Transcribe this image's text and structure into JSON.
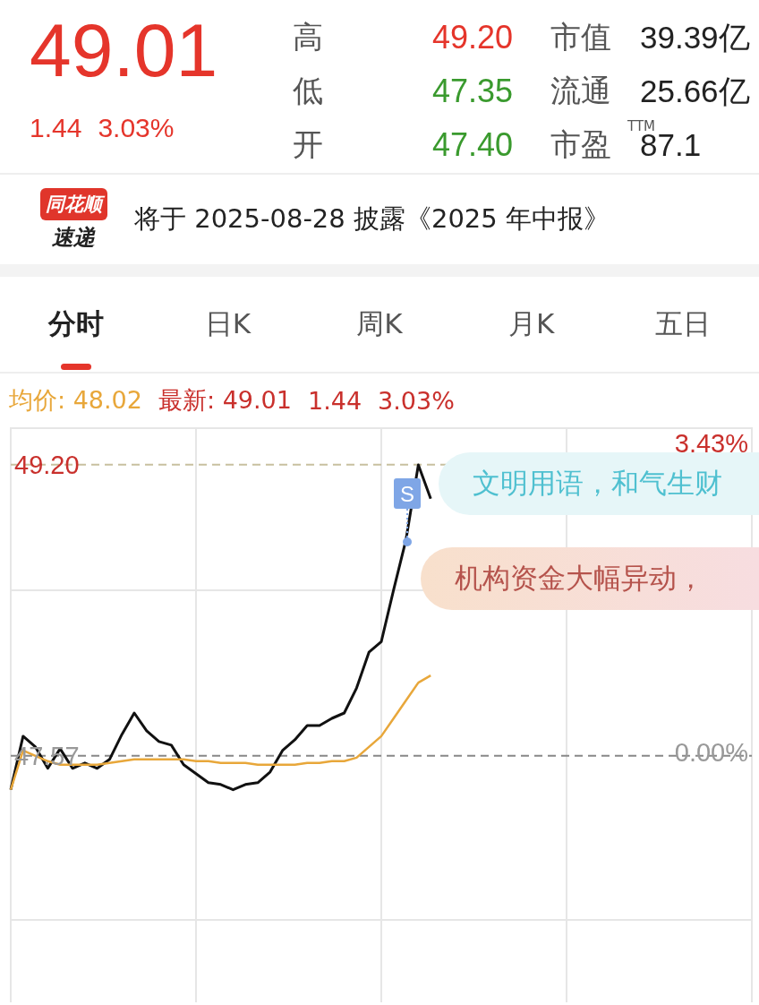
{
  "quote": {
    "price": "49.01",
    "change": "1.44",
    "change_pct": "3.03%"
  },
  "stats": [
    {
      "label": "高",
      "value": "49.20",
      "color": "#e5352b"
    },
    {
      "label": "低",
      "value": "47.35",
      "color": "#3a9a2e"
    },
    {
      "label": "开",
      "value": "47.40",
      "color": "#3a9a2e"
    }
  ],
  "metrics": [
    {
      "label": "市值",
      "value": "39.39亿"
    },
    {
      "label": "流通",
      "value": "25.66亿"
    },
    {
      "label": "市盈",
      "sup": "TTM",
      "value": "87.1"
    }
  ],
  "news": {
    "logo_top": "同花顺",
    "logo_bottom": "速递",
    "text": "将于 2025-08-28 披露《2025 年中报》"
  },
  "tabs": [
    {
      "label": "分时",
      "selected": true
    },
    {
      "label": "日K",
      "selected": false
    },
    {
      "label": "周K",
      "selected": false
    },
    {
      "label": "月K",
      "selected": false
    },
    {
      "label": "五日",
      "selected": false
    }
  ],
  "summary": {
    "avg_label": "均价:",
    "avg": "48.02",
    "latest_label": "最新:",
    "latest": "49.01",
    "change": "1.44",
    "change_pct": "3.03%"
  },
  "chart": {
    "chart_data": {
      "type": "line",
      "categories": [
        null,
        null,
        null,
        null,
        null,
        null,
        null,
        null,
        null,
        null,
        null,
        null,
        null,
        null,
        null,
        null,
        null,
        null,
        null,
        null,
        null,
        null,
        null,
        null,
        null,
        null,
        null,
        null,
        null,
        null,
        null,
        null,
        null,
        null,
        null,
        null,
        null,
        null,
        null,
        null,
        null,
        null,
        null,
        null,
        null,
        null,
        null,
        null,
        null,
        null,
        null,
        null,
        null,
        null,
        null,
        null,
        null,
        null,
        null,
        null,
        null
      ],
      "series": [
        {
          "color": "#111111",
          "values": [
            47.38,
            47.68,
            47.62,
            47.5,
            47.61,
            47.5,
            47.53,
            47.5,
            47.55,
            47.69,
            47.81,
            47.71,
            47.65,
            47.63,
            47.52,
            47.47,
            47.42,
            47.41,
            47.38,
            47.41,
            47.42,
            47.48,
            47.6,
            47.66,
            47.74,
            47.74,
            47.78,
            47.81,
            47.95,
            48.15,
            48.21,
            48.5,
            48.78,
            49.2,
            49.01,
            null,
            null,
            null,
            null,
            null,
            null,
            null,
            null,
            null,
            null,
            null,
            null,
            null,
            null,
            null,
            null,
            null,
            null,
            null,
            null,
            null,
            null,
            null,
            null,
            null,
            null
          ]
        },
        {
          "color": "#e8a73a",
          "values": [
            47.38,
            47.6,
            47.57,
            47.54,
            47.52,
            47.52,
            47.52,
            47.52,
            47.53,
            47.54,
            47.55,
            47.55,
            47.55,
            47.55,
            47.55,
            47.54,
            47.54,
            47.53,
            47.53,
            47.53,
            47.52,
            47.52,
            47.52,
            47.52,
            47.53,
            47.53,
            47.54,
            47.54,
            47.56,
            47.62,
            47.68,
            47.78,
            47.88,
            47.98,
            48.02,
            null,
            null,
            null,
            null,
            null,
            null,
            null,
            null,
            null,
            null,
            null,
            null,
            null,
            null,
            null,
            null,
            null,
            null,
            null,
            null,
            null,
            null,
            null,
            null,
            null,
            null
          ]
        }
      ],
      "ylim": [
        46.19,
        49.41
      ],
      "grid": true,
      "ref_lines": [
        {
          "axis": "y",
          "value": 49.2,
          "color": "#c8c0a0"
        },
        {
          "axis": "y",
          "value": 47.57,
          "color": "#888888"
        }
      ],
      "yticks": [
        {
          "value": 49.2,
          "label": "49.20"
        },
        {
          "value": 47.57,
          "label": "47.57"
        }
      ]
    },
    "pct_labels": [
      "3.43%",
      "0.00%"
    ],
    "signal": {
      "label": "S"
    },
    "bubbles": [
      {
        "text": "文明用语，和气生财",
        "kind": "teal"
      },
      {
        "text": "机构资金大幅异动，",
        "kind": "pink"
      }
    ]
  }
}
